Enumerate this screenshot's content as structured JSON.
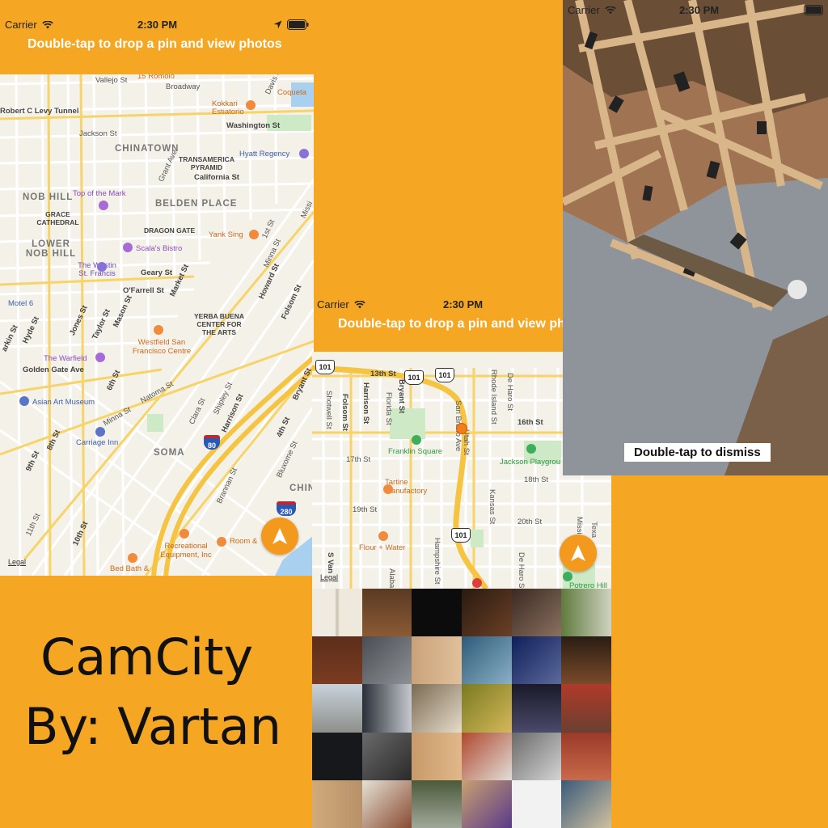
{
  "status_bar": {
    "carrier": "Carrier",
    "time": "2:30 PM"
  },
  "screen1": {
    "instruction": "Double-tap to drop a pin and view photos",
    "legal": "Legal",
    "labels": {
      "vallejo": "Vallejo St",
      "romolo": "15 Romolo",
      "broadway": "Broadway",
      "davis": "Davis St",
      "coqueta": "Coqueta",
      "tunnel": "Robert C Levy Tunnel",
      "kokkari": "Kokkari Estiatorio",
      "washington": "Washington St",
      "jackson": "Jackson St",
      "chinatown": "CHINATOWN",
      "transamerica": "TRANSAMERICA PYRAMID",
      "hyatt": "Hyatt Regency",
      "nobhill": "NOB HILL",
      "grant": "Grant Ave",
      "california": "California St",
      "topmark": "Top of the Mark",
      "grace": "GRACE CATHEDRAL",
      "belden": "BELDEN PLACE",
      "dragon": "DRAGON GATE",
      "first": "1st St",
      "mission": "Missi",
      "lower": "LOWER NOB HILL",
      "yank": "Yank Sing",
      "scala": "Scala's Bistro",
      "westin": "The Westin St. Francis",
      "geary": "Geary St",
      "minna": "Minna St",
      "ofarrell": "O'Farrell St",
      "market": "Market St",
      "howard": "Howard St",
      "folsom": "Folsom St",
      "motel": "Motel 6",
      "yerba": "YERBA BUENA CENTER FOR THE ARTS",
      "jones": "Jones St",
      "taylor": "Taylor St",
      "mason": "Mason St",
      "hyde": "Hyde St",
      "larkin": "arkin St",
      "westfield": "Westfield San Francisco Centre",
      "warfield": "The Warfield",
      "goldengate": "Golden Gate Ave",
      "sixth": "6th St",
      "natoma": "Natoma St",
      "bryant": "Bryant St",
      "asian": "Asian Art Museum",
      "minna2": "Minna St",
      "shipley": "Shipley St",
      "harrison": "Harrison St",
      "fourth": "4th St",
      "eighth": "8th St",
      "carriage": "Carriage Inn",
      "clara": "Clara St",
      "ninth": "9th St",
      "soma": "SOMA",
      "bluxome": "Bluxome St",
      "chin": "CHIN",
      "brannan": "Brannan St",
      "eleventh": "11th St",
      "tenth": "10th St",
      "recreational": "Recreational Equipment, Inc",
      "room": "Room &",
      "bedbath": "Bed Bath &"
    },
    "shields": {
      "i80": "80",
      "i280": "280"
    }
  },
  "screen2": {
    "instruction": "Double-tap to drop a pin and view pho",
    "legal": "Legal",
    "labels": {
      "thirteenth": "13th St",
      "folsom": "Folsom St",
      "harrison": "Harrison St",
      "florida": "Florida St",
      "bryant": "Bryant St",
      "deharo": "De Haro St",
      "rhodeisland": "Rhode Island St",
      "shotwell": "Shotwell St",
      "sixteenth": "16th St",
      "franklin": "Franklin Square",
      "jackson": "Jackson Playgrou",
      "seventeenth": "17th St",
      "eighteenth": "18th St",
      "tartine": "Tartine Manufactory",
      "kansas": "Kansas St",
      "utah": "Utah St",
      "sanbruno": "San Bruno Ave",
      "nineteenth": "19th St",
      "twentieth": "20th St",
      "flour": "Flour + Water",
      "hampshire": "Hampshire St",
      "deharo2": "De Haro St",
      "svan": "S Van",
      "alabama": "Alaba",
      "potrero": "Potrero Hill",
      "texas": "Texa",
      "mississippi": "Missi"
    },
    "shields": {
      "us101a": "101",
      "us101b": "101",
      "us101c": "101",
      "us101d": "101"
    }
  },
  "screen3": {
    "dismiss": "Double-tap to dismiss"
  },
  "title": {
    "line1": "CamCity",
    "line2": "By: Vartan"
  },
  "colors": {
    "background": "#F5A623",
    "accent": "#F39A1E"
  },
  "icons": [
    "wifi-icon",
    "location-arrow-icon",
    "battery-icon",
    "poi-icon",
    "interstate-shield-icon",
    "us-highway-shield-icon"
  ]
}
